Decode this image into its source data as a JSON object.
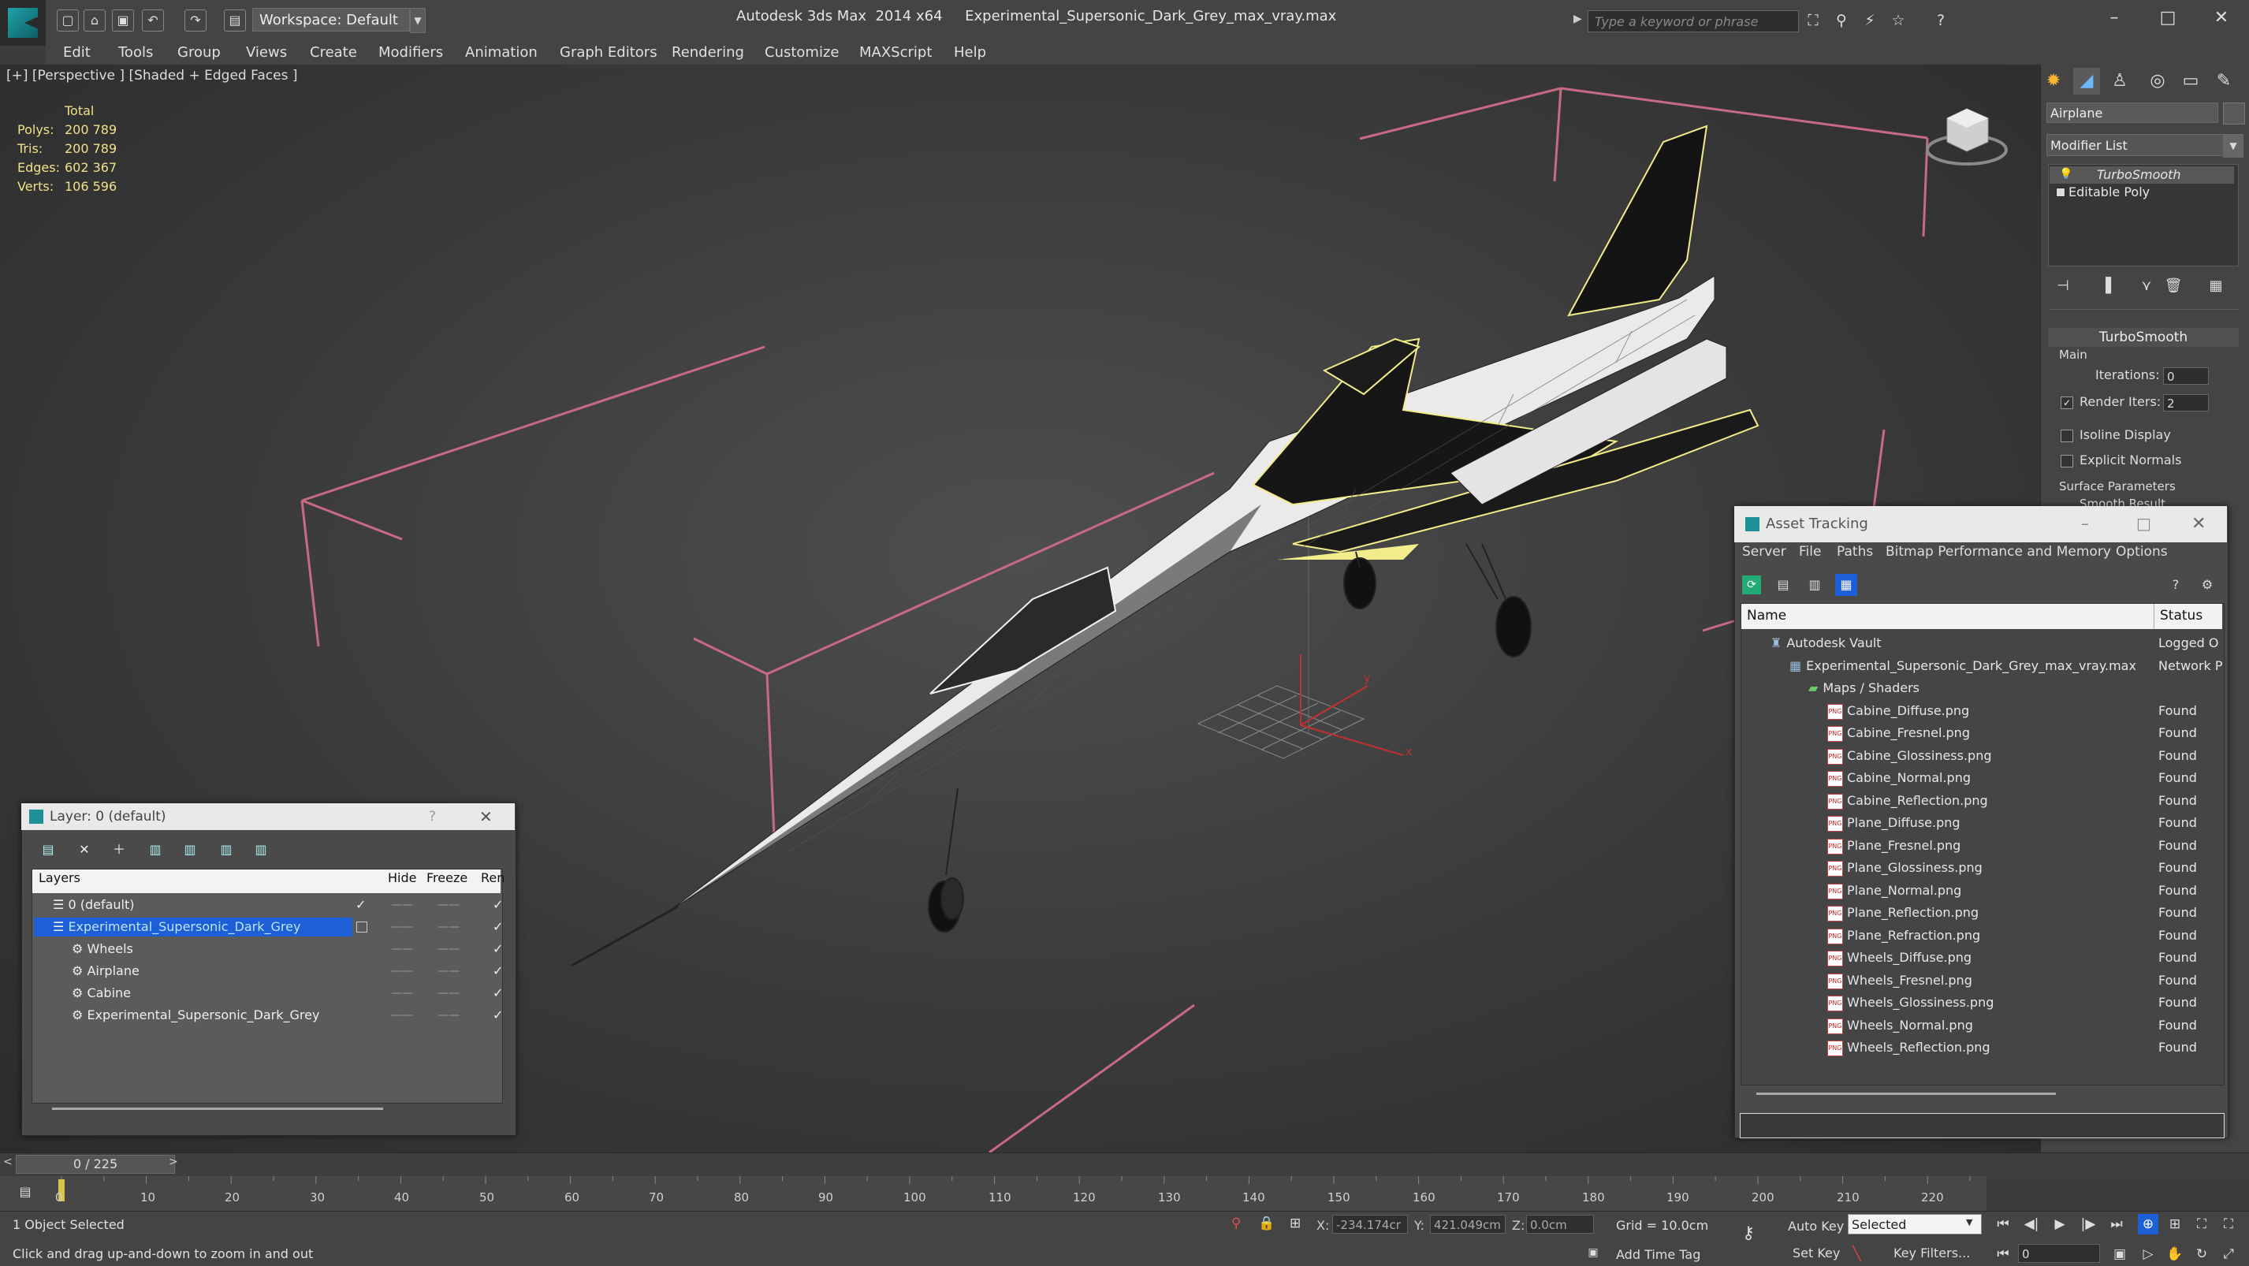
{
  "titlebar": {
    "workspace": "Workspace: Default",
    "app": "Autodesk 3ds Max  2014 x64",
    "file": "Experimental_Supersonic_Dark_Grey_max_vray.max",
    "search_placeholder": "Type a keyword or phrase"
  },
  "menu": [
    "Edit",
    "Tools",
    "Group",
    "Views",
    "Create",
    "Modifiers",
    "Animation",
    "Graph Editors",
    "Rendering",
    "Customize",
    "MAXScript",
    "Help"
  ],
  "viewport": {
    "label": "[+] [Perspective ] [Shaded + Edged Faces ]",
    "stats": {
      "header": "Total",
      "rows": [
        {
          "label": "Polys:",
          "value": "200 789"
        },
        {
          "label": "Tris:",
          "value": "200 789"
        },
        {
          "label": "Edges:",
          "value": "602 367"
        },
        {
          "label": "Verts:",
          "value": "106 596"
        }
      ]
    },
    "gizmo_x": "x",
    "gizmo_y": "y"
  },
  "command_panel": {
    "object_name": "Airplane",
    "modifier_list": "Modifier List",
    "stack": [
      "TurboSmooth",
      "Editable Poly"
    ],
    "rollout_title": "TurboSmooth",
    "group_main": "Main",
    "iterations_label": "Iterations:",
    "iterations_value": "0",
    "render_iters_label": "Render Iters:",
    "render_iters_value": "2",
    "isoline_label": "Isoline Display",
    "explicit_normals_label": "Explicit Normals",
    "surface_params_label": "Surface Parameters",
    "smooth_result_label": "Smooth Result"
  },
  "layer_dialog": {
    "title": "Layer: 0 (default)",
    "help": "?",
    "columns": [
      "Layers",
      "Hide",
      "Freeze",
      "Ren"
    ],
    "rows": [
      {
        "name": "0 (default)",
        "level": 0,
        "selected": false,
        "current": true
      },
      {
        "name": "Experimental_Supersonic_Dark_Grey",
        "level": 0,
        "selected": true,
        "current": false
      },
      {
        "name": "Wheels",
        "level": 1,
        "selected": false,
        "current": false
      },
      {
        "name": "Airplane",
        "level": 1,
        "selected": false,
        "current": false
      },
      {
        "name": "Cabine",
        "level": 1,
        "selected": false,
        "current": false
      },
      {
        "name": "Experimental_Supersonic_Dark_Grey",
        "level": 1,
        "selected": false,
        "current": false
      }
    ]
  },
  "asset_tracking": {
    "title": "Asset Tracking",
    "menu": [
      "Server",
      "File",
      "Paths",
      "Bitmap Performance and Memory",
      "Options"
    ],
    "columns": [
      "Name",
      "Status"
    ],
    "rows": [
      {
        "name": "Autodesk Vault",
        "status": "Logged O",
        "level": 0,
        "icon": "vault-icon"
      },
      {
        "name": "Experimental_Supersonic_Dark_Grey_max_vray.max",
        "status": "Network P",
        "level": 1,
        "icon": "max-file-icon"
      },
      {
        "name": "Maps / Shaders",
        "status": "",
        "level": 2,
        "icon": "maps-folder-icon"
      },
      {
        "name": "Cabine_Diffuse.png",
        "status": "Found",
        "level": 3,
        "icon": "png-icon"
      },
      {
        "name": "Cabine_Fresnel.png",
        "status": "Found",
        "level": 3,
        "icon": "png-icon"
      },
      {
        "name": "Cabine_Glossiness.png",
        "status": "Found",
        "level": 3,
        "icon": "png-icon"
      },
      {
        "name": "Cabine_Normal.png",
        "status": "Found",
        "level": 3,
        "icon": "png-icon"
      },
      {
        "name": "Cabine_Reflection.png",
        "status": "Found",
        "level": 3,
        "icon": "png-icon"
      },
      {
        "name": "Plane_Diffuse.png",
        "status": "Found",
        "level": 3,
        "icon": "png-icon"
      },
      {
        "name": "Plane_Fresnel.png",
        "status": "Found",
        "level": 3,
        "icon": "png-icon"
      },
      {
        "name": "Plane_Glossiness.png",
        "status": "Found",
        "level": 3,
        "icon": "png-icon"
      },
      {
        "name": "Plane_Normal.png",
        "status": "Found",
        "level": 3,
        "icon": "png-icon"
      },
      {
        "name": "Plane_Reflection.png",
        "status": "Found",
        "level": 3,
        "icon": "png-icon"
      },
      {
        "name": "Plane_Refraction.png",
        "status": "Found",
        "level": 3,
        "icon": "png-icon"
      },
      {
        "name": "Wheels_Diffuse.png",
        "status": "Found",
        "level": 3,
        "icon": "png-icon"
      },
      {
        "name": "Wheels_Fresnel.png",
        "status": "Found",
        "level": 3,
        "icon": "png-icon"
      },
      {
        "name": "Wheels_Glossiness.png",
        "status": "Found",
        "level": 3,
        "icon": "png-icon"
      },
      {
        "name": "Wheels_Normal.png",
        "status": "Found",
        "level": 3,
        "icon": "png-icon"
      },
      {
        "name": "Wheels_Reflection.png",
        "status": "Found",
        "level": 3,
        "icon": "png-icon"
      }
    ]
  },
  "timeline": {
    "frame_display": "0 / 225",
    "ticks": [
      "0",
      "10",
      "20",
      "30",
      "40",
      "50",
      "60",
      "70",
      "80",
      "90",
      "100",
      "110",
      "120",
      "130",
      "140",
      "150",
      "160",
      "170",
      "180",
      "190",
      "200",
      "210",
      "220"
    ]
  },
  "status": {
    "selection": "1 Object Selected",
    "prompt": "Click and drag up-and-down to zoom in and out",
    "x_label": "X:",
    "x_value": "-234.174cr",
    "y_label": "Y:",
    "y_value": "421.049cm",
    "z_label": "Z:",
    "z_value": "0.0cm",
    "grid": "Grid = 10.0cm",
    "add_time_tag": "Add Time Tag",
    "auto_key": "Auto Key",
    "set_key": "Set Key",
    "selected": "Selected",
    "key_filters": "Key Filters...",
    "current_frame": "0"
  },
  "colors": {
    "accent_blue": "#1d5fd6",
    "selection_box": "#c86a84",
    "stats_text": "#f0e28a",
    "wire": "#ffffff",
    "wire_highlight": "#f3ec8a"
  }
}
